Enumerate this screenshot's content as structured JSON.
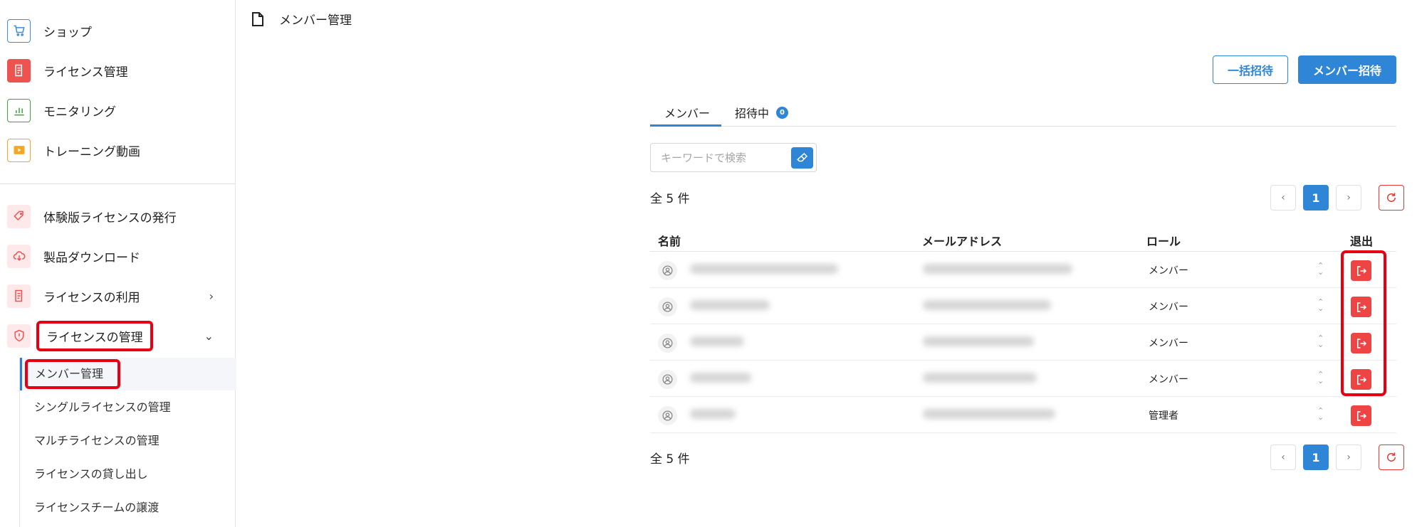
{
  "sidebar": {
    "top_items": [
      {
        "label": "ショップ",
        "icon": "cart-icon"
      },
      {
        "label": "ライセンス管理",
        "icon": "license-icon"
      },
      {
        "label": "モニタリング",
        "icon": "bar-chart-icon"
      },
      {
        "label": "トレーニング動画",
        "icon": "play-icon"
      }
    ],
    "bottom_items": [
      {
        "label": "体験版ライセンスの発行",
        "icon": "tag-icon"
      },
      {
        "label": "製品ダウンロード",
        "icon": "cloud-download-icon"
      },
      {
        "label": "ライセンスの利用",
        "icon": "license-icon"
      },
      {
        "label": "ライセンスの管理",
        "icon": "shield-icon"
      }
    ],
    "sub_items": [
      {
        "label": "メンバー管理"
      },
      {
        "label": "シングルライセンスの管理"
      },
      {
        "label": "マルチライセンスの管理"
      },
      {
        "label": "ライセンスの貸し出し"
      },
      {
        "label": "ライセンスチームの譲渡"
      }
    ]
  },
  "header": {
    "title": "メンバー管理"
  },
  "actions": {
    "bulk_invite": "一括招待",
    "invite": "メンバー招待"
  },
  "tabs": {
    "members": "メンバー",
    "invited": "招待中",
    "invited_count": "0"
  },
  "search": {
    "placeholder": "キーワードで検索"
  },
  "count_text": "全 5 件",
  "pagination": {
    "prev": "‹",
    "current": "1",
    "next": "›"
  },
  "table": {
    "headers": {
      "name": "名前",
      "email": "メールアドレス",
      "role": "ロール",
      "leave": "退出"
    },
    "rows": [
      {
        "role": "メンバー"
      },
      {
        "role": "メンバー"
      },
      {
        "role": "メンバー"
      },
      {
        "role": "メンバー"
      },
      {
        "role": "管理者"
      }
    ]
  },
  "colors": {
    "primary": "#2f86d6",
    "danger": "#ef4444",
    "highlight": "#e60012"
  }
}
